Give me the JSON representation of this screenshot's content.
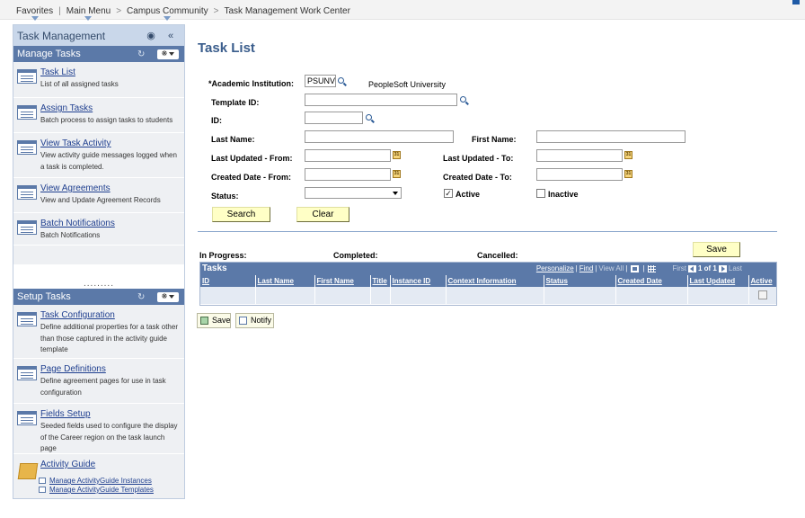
{
  "breadcrumb": [
    "Favorites",
    "Main Menu",
    "Campus Community",
    "Task Management Work Center"
  ],
  "nav": {
    "title": "Task Management",
    "manage_tasks": {
      "title": "Manage Tasks",
      "items": [
        {
          "label": "Task List",
          "desc": "List of all assigned tasks"
        },
        {
          "label": "Assign Tasks",
          "desc": "Batch process to assign tasks to students"
        },
        {
          "label": "View Task Activity",
          "desc": "View activity guide messages logged when a task is completed."
        },
        {
          "label": "View Agreements",
          "desc": "View and Update Agreement Records"
        },
        {
          "label": "Batch Notifications",
          "desc": "Batch Notifications"
        }
      ],
      "more": "........."
    },
    "setup_tasks": {
      "title": "Setup Tasks",
      "items": [
        {
          "label": "Task Configuration",
          "desc": "Define additional properties for a task other than those captured in the activity guide template"
        },
        {
          "label": "Page Definitions",
          "desc": "Define agreement pages for use in task configuration"
        },
        {
          "label": "Fields Setup",
          "desc": "Seeded fields used to configure the display of the Career region on the task launch page"
        }
      ],
      "folder": {
        "label": "Activity Guide",
        "links": [
          "Manage ActivityGuide Instances",
          "Manage ActivityGuide Templates"
        ]
      }
    }
  },
  "page": {
    "title": "Task List",
    "fields": {
      "academic_institution_label": "*Academic Institution:",
      "academic_institution_value": "PSUNV",
      "institution_name": "PeopleSoft University",
      "template_id_label": "Template ID:",
      "id_label": "ID:",
      "last_name_label": "Last Name:",
      "first_name_label": "First Name:",
      "last_updated_from_label": "Last Updated - From:",
      "last_updated_to_label": "Last Updated - To:",
      "created_from_label": "Created Date - From:",
      "created_to_label": "Created Date - To:",
      "status_label": "Status:",
      "active_label": "Active",
      "inactive_label": "Inactive",
      "active_checked": true,
      "inactive_checked": false,
      "calendar_glyph": "31"
    },
    "buttons": {
      "search": "Search",
      "clear": "Clear",
      "save": "Save",
      "save_bottom": "Save",
      "notify": "Notify"
    },
    "status_summary": {
      "in_progress": "In Progress:",
      "completed": "Completed:",
      "cancelled": "Cancelled:"
    },
    "grid": {
      "title": "Tasks",
      "personalize": "Personalize",
      "find": "Find",
      "view_all": "View All",
      "first": "First",
      "range": "1 of 1",
      "last": "Last",
      "columns": [
        "ID",
        "Last Name",
        "First Name",
        "Title",
        "Instance ID",
        "Context Information",
        "Status",
        "Created Date",
        "Last Updated",
        "Active"
      ]
    }
  }
}
